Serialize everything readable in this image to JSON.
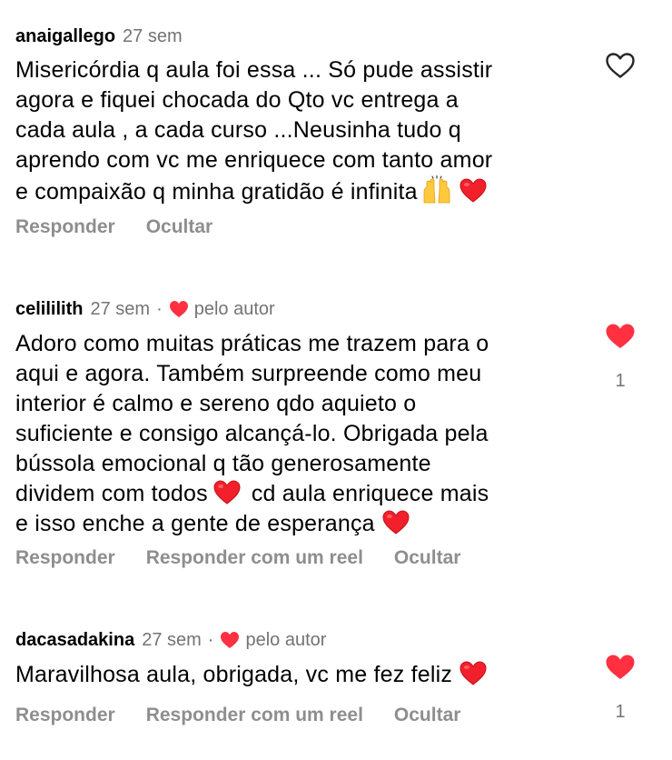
{
  "colors": {
    "heart_red": "#FF3040",
    "muted_text": "#737373",
    "action_text": "#8E8E8E"
  },
  "comments": [
    {
      "username": "anaigallego",
      "time": "27 sem",
      "liked_by_author": false,
      "liked": false,
      "like_icon": "heart-outline-icon",
      "text_lines": [
        "Misericórdia q aula foi essa ... Só pude assistir",
        "agora e fiquei chocada do Qto vc entrega a",
        "cada aula , a cada curso ...Neusinha tudo q",
        "aprendo com vc me enriquece com tanto amor",
        "e compaixão q minha gratidão é infinita"
      ],
      "actions": [
        "Responder",
        "Ocultar"
      ]
    },
    {
      "username": "celililith",
      "time": "27 sem",
      "separator": "·",
      "liked_by_author": true,
      "liked_by_label": "pelo autor",
      "liked": true,
      "like_icon": "heart-filled-icon",
      "like_count": "1",
      "text_lines": [
        "Adoro como muitas práticas me trazem para o",
        "aqui e agora. Também surpreende como meu",
        "interior é calmo e sereno qdo aquieto o",
        "suficiente e consigo alcançá-lo. Obrigada pela",
        "bússola emocional q tão generosamente",
        "dividem com todos",
        "cd aula enriquece mais",
        "e isso enche a gente de esperança"
      ],
      "actions": [
        "Responder",
        "Responder com um reel",
        "Ocultar"
      ]
    },
    {
      "username": "dacasadakina",
      "time": "27 sem",
      "separator": "·",
      "liked_by_author": true,
      "liked_by_label": "pelo autor",
      "liked": true,
      "like_icon": "heart-filled-icon",
      "like_count": "1",
      "text_lines": [
        "Maravilhosa aula, obrigada, vc me fez feliz"
      ],
      "actions": [
        "Responder",
        "Responder com um reel",
        "Ocultar"
      ]
    }
  ]
}
